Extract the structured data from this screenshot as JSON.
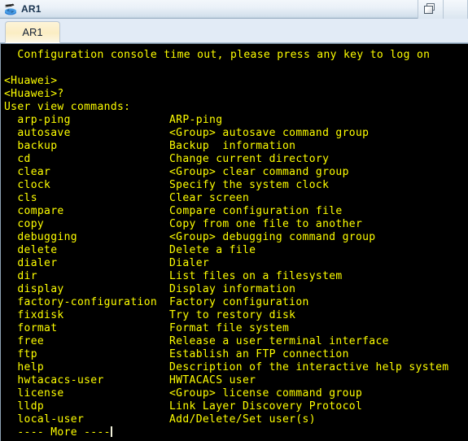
{
  "window": {
    "title": "AR1",
    "icon": "router-device-icon",
    "controls": [
      {
        "name": "restore-window-button",
        "icon": "restore-icon",
        "label": ""
      }
    ]
  },
  "tabs": [
    {
      "label": "AR1",
      "active": true
    }
  ],
  "terminal": {
    "colors": {
      "background": "#000000",
      "text": "#ffff00",
      "cursor": "#f2f2dc"
    },
    "lines": [
      "  Configuration console time out, please press any key to log on",
      "",
      "<Huawei>",
      "<Huawei>?",
      "User view commands:"
    ],
    "commands": [
      {
        "name": "arp-ping",
        "desc": "ARP-ping"
      },
      {
        "name": "autosave",
        "desc": "<Group> autosave command group"
      },
      {
        "name": "backup",
        "desc": "Backup  information"
      },
      {
        "name": "cd",
        "desc": "Change current directory"
      },
      {
        "name": "clear",
        "desc": "<Group> clear command group"
      },
      {
        "name": "clock",
        "desc": "Specify the system clock"
      },
      {
        "name": "cls",
        "desc": "Clear screen"
      },
      {
        "name": "compare",
        "desc": "Compare configuration file"
      },
      {
        "name": "copy",
        "desc": "Copy from one file to another"
      },
      {
        "name": "debugging",
        "desc": "<Group> debugging command group"
      },
      {
        "name": "delete",
        "desc": "Delete a file"
      },
      {
        "name": "dialer",
        "desc": "Dialer"
      },
      {
        "name": "dir",
        "desc": "List files on a filesystem"
      },
      {
        "name": "display",
        "desc": "Display information"
      },
      {
        "name": "factory-configuration",
        "desc": "Factory configuration"
      },
      {
        "name": "fixdisk",
        "desc": "Try to restory disk"
      },
      {
        "name": "format",
        "desc": "Format file system"
      },
      {
        "name": "free",
        "desc": "Release a user terminal interface"
      },
      {
        "name": "ftp",
        "desc": "Establish an FTP connection"
      },
      {
        "name": "help",
        "desc": "Description of the interactive help system"
      },
      {
        "name": "hwtacacs-user",
        "desc": "HWTACACS user"
      },
      {
        "name": "license",
        "desc": "<Group> license command group"
      },
      {
        "name": "lldp",
        "desc": "Link Layer Discovery Protocol"
      },
      {
        "name": "local-user",
        "desc": "Add/Delete/Set user(s)"
      }
    ],
    "pager_prompt": "  ---- More ----"
  }
}
